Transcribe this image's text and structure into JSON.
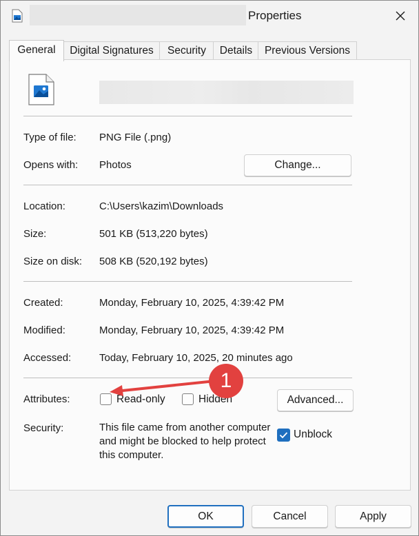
{
  "window": {
    "title": "Properties",
    "close_icon": "close-icon",
    "title_icon": "image-file-icon"
  },
  "tabs": [
    {
      "label": "General",
      "active": true
    },
    {
      "label": "Digital Signatures",
      "active": false
    },
    {
      "label": "Security",
      "active": false
    },
    {
      "label": "Details",
      "active": false
    },
    {
      "label": "Previous Versions",
      "active": false
    }
  ],
  "general": {
    "file_icon": "png-image-file-icon",
    "type_label": "Type of file:",
    "type_value": "PNG File (.png)",
    "opens_label": "Opens with:",
    "opens_value": "Photos",
    "change_button": "Change...",
    "location_label": "Location:",
    "location_value": "C:\\Users\\kazim\\Downloads",
    "size_label": "Size:",
    "size_value": "501 KB (513,220 bytes)",
    "size_disk_label": "Size on disk:",
    "size_disk_value": "508 KB (520,192 bytes)",
    "created_label": "Created:",
    "created_value": "Monday, February 10, 2025, 4:39:42 PM",
    "modified_label": "Modified:",
    "modified_value": "Monday, February 10, 2025, 4:39:42 PM",
    "accessed_label": "Accessed:",
    "accessed_value": "Today, February 10, 2025, 20 minutes ago",
    "attributes_label": "Attributes:",
    "readonly_label": "Read-only",
    "readonly_checked": false,
    "hidden_label": "Hidden",
    "hidden_checked": false,
    "advanced_button": "Advanced...",
    "security_label": "Security:",
    "security_text": "This file came from another computer and might be blocked to help protect this computer.",
    "unblock_label": "Unblock",
    "unblock_checked": true
  },
  "footer": {
    "ok": "OK",
    "cancel": "Cancel",
    "apply": "Apply"
  },
  "annotation": {
    "badge": "1",
    "color": "#e2413f"
  },
  "colors": {
    "accent": "#1f6fbf"
  }
}
